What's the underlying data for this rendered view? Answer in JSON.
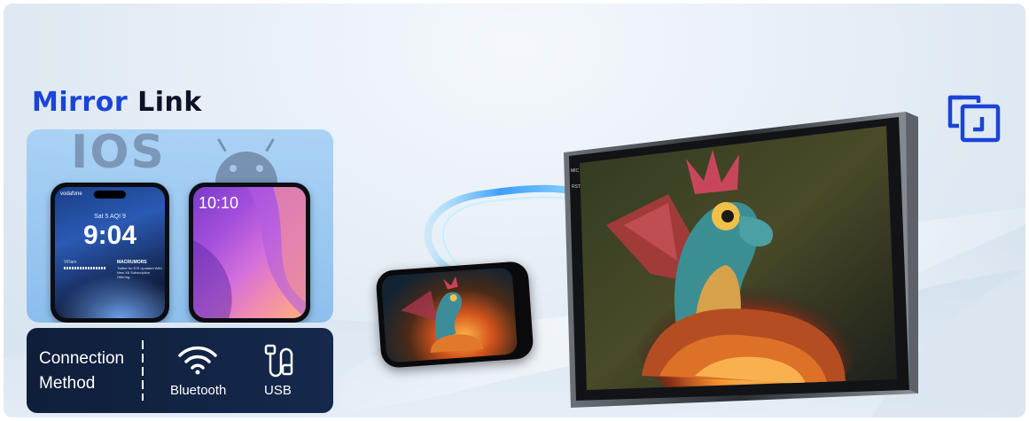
{
  "title": {
    "part1": "Mirror",
    "part2": "Link"
  },
  "os_labels": {
    "ios": "IOS"
  },
  "ios_phone": {
    "carrier": "vodafone",
    "date": "Sat 5  AQI 9",
    "time": "9:04",
    "widget": "VFlam",
    "notification_title": "MACRUMORS",
    "notification_body": "Twitter for iOS Updated With New X8 Subscription Offering..."
  },
  "android_phone": {
    "time": "10:10"
  },
  "connection": {
    "label_line1": "Connection",
    "label_line2": "Method",
    "options": [
      "Bluetooth",
      "USB"
    ]
  },
  "icons": [
    "mirror-link-icon",
    "wifi-icon",
    "usb-cable-icon",
    "android-robot-icon"
  ],
  "tablet": {
    "side_labels": [
      "MIC",
      "RST"
    ]
  },
  "colors": {
    "accent": "#1a44d8",
    "dark_panel": "#0f1e3a",
    "text_dark": "#0c1326"
  }
}
